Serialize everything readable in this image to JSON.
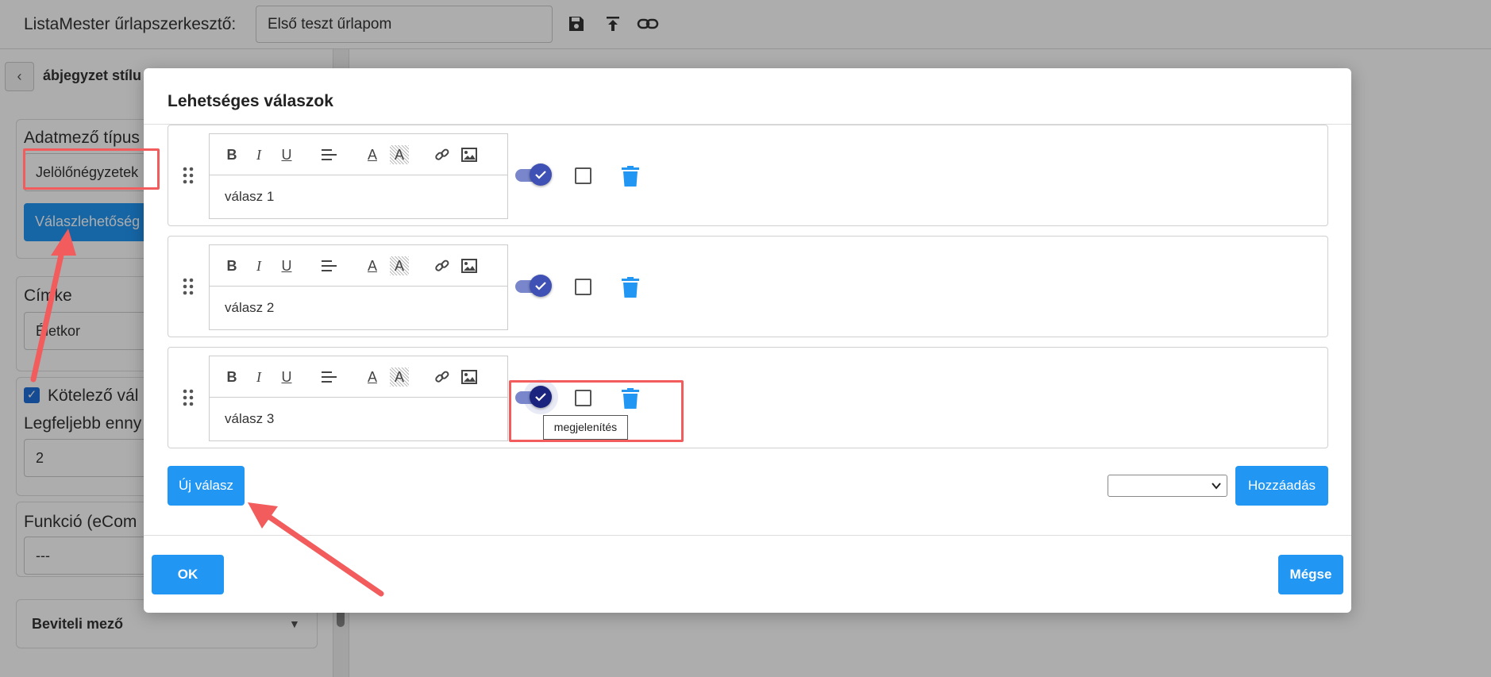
{
  "app": {
    "title": "ListaMester űrlapszerkesztő:",
    "form_name": "Első teszt űrlapom"
  },
  "top_icons": [
    "save-icon",
    "upload-icon",
    "link-icon"
  ],
  "left_panel": {
    "back_label": "‹",
    "breadcrumb": "ábjegyzet stílu",
    "field_type_label": "Adatmező típus",
    "field_type_value": "Jelölőnégyzetek",
    "answer_options_button": "Válaszlehetőség",
    "label_label": "Címke",
    "label_value": "Életkor",
    "required_label": "Kötelező vál",
    "max_label": "Legfeljebb enny",
    "max_value": "2",
    "function_label": "Funkció (eCom",
    "function_value": "---",
    "input_field_section": "Beviteli mező",
    "collapse_arrow": "▼"
  },
  "modal": {
    "title": "Lehetséges válaszok",
    "answers": [
      {
        "text": "válasz 1",
        "visible": true,
        "checked": false
      },
      {
        "text": "válasz 2",
        "visible": true,
        "checked": false
      },
      {
        "text": "válasz 3",
        "visible": true,
        "checked": false
      }
    ],
    "toolbar": {
      "bold": "B",
      "italic": "I",
      "underline": "U",
      "font_color": "A",
      "highlight": "A"
    },
    "tooltip": "megjelenítés",
    "new_answer_button": "Új válasz",
    "add_button": "Hozzáadás",
    "ok_button": "OK",
    "cancel_button": "Mégse"
  },
  "colors": {
    "primary": "#2196f3",
    "toggle": "#3f51b5",
    "annotation": "#f25c5c",
    "trash": "#2196f3"
  }
}
